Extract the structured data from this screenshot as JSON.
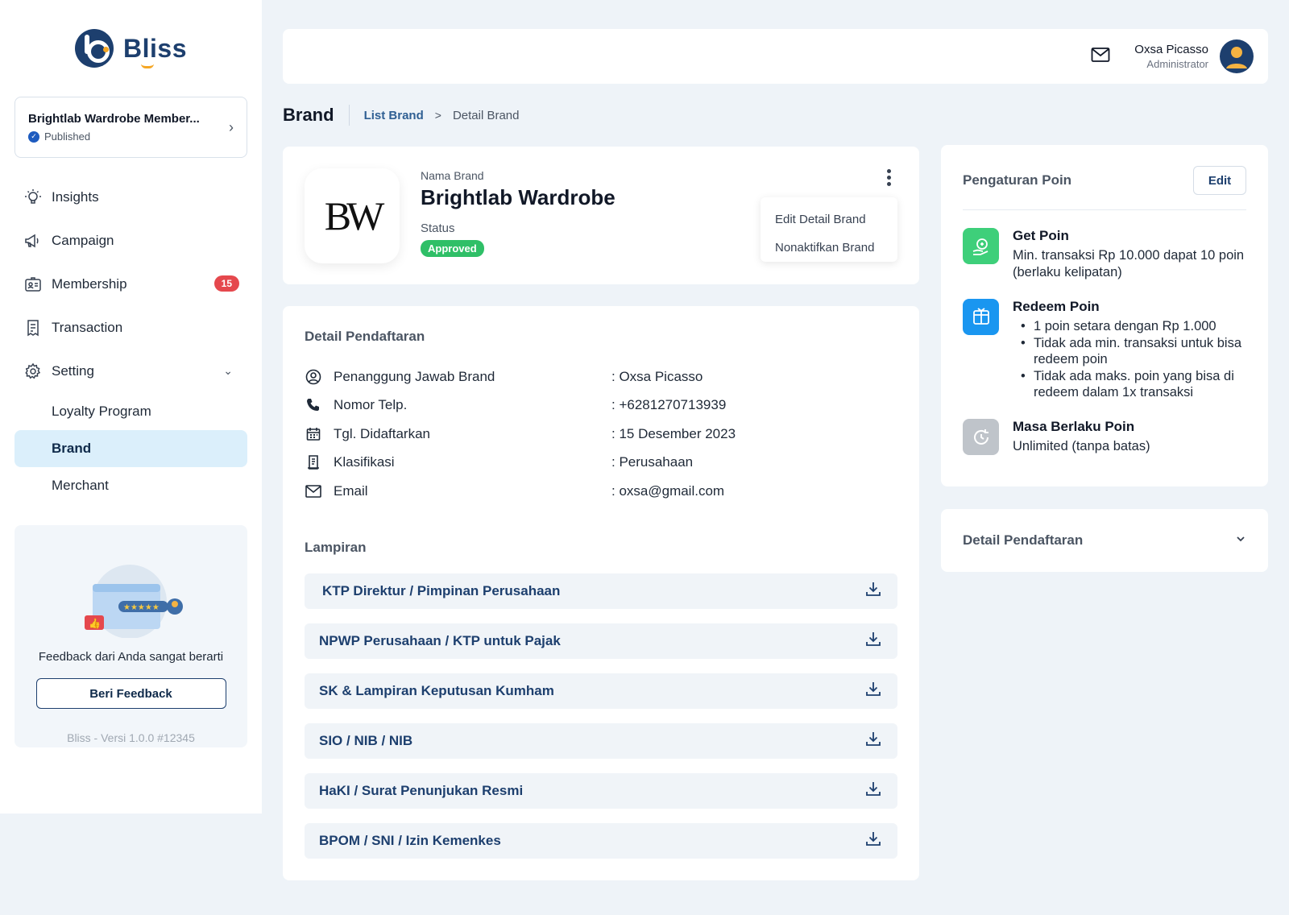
{
  "app": {
    "logo_text": "Bliss"
  },
  "project": {
    "name": "Brightlab Wardrobe Member...",
    "status": "Published"
  },
  "nav": {
    "insights": "Insights",
    "campaign": "Campaign",
    "membership": "Membership",
    "membership_badge": "15",
    "transaction": "Transaction",
    "setting": "Setting",
    "sub": {
      "loyalty": "Loyalty Program",
      "brand": "Brand",
      "merchant": "Merchant"
    }
  },
  "feedback": {
    "text": "Feedback dari Anda sangat berarti",
    "button": "Beri Feedback"
  },
  "version": "Bliss - Versi 1.0.0 #12345",
  "user": {
    "name": "Oxsa Picasso",
    "role": "Administrator"
  },
  "breadcrumb": {
    "title": "Brand",
    "link": "List Brand",
    "separator": ">",
    "current": "Detail Brand"
  },
  "brand": {
    "logo_text": "BW",
    "name_label": "Nama Brand",
    "name": "Brightlab Wardrobe",
    "status_label": "Status",
    "status": "Approved",
    "status_color": "#2fbf67",
    "menu": {
      "edit": "Edit Detail Brand",
      "deactivate": "Nonaktifkan Brand"
    }
  },
  "detail": {
    "title": "Detail Pendaftaran",
    "rows": [
      {
        "icon": "person-icon",
        "label": "Penanggung Jawab Brand",
        "value": ": Oxsa Picasso"
      },
      {
        "icon": "phone-icon",
        "label": "Nomor Telp.",
        "value": ": +6281270713939"
      },
      {
        "icon": "calendar-icon",
        "label": "Tgl. Didaftarkan",
        "value": ": 15 Desember 2023"
      },
      {
        "icon": "document-icon",
        "label": "Klasifikasi",
        "value": ": Perusahaan"
      },
      {
        "icon": "mail-icon",
        "label": "Email",
        "value": ": oxsa@gmail.com"
      }
    ],
    "attachments_title": "Lampiran",
    "attachments": [
      "KTP Direktur / Pimpinan Perusahaan",
      "NPWP Perusahaan / KTP untuk Pajak",
      "SK & Lampiran Keputusan Kumham",
      "SIO / NIB / NIB",
      "HaKI / Surat Penunjukan Resmi",
      "BPOM / SNI / Izin Kemenkes"
    ]
  },
  "poin": {
    "title": "Pengaturan Poin",
    "edit": "Edit",
    "get": {
      "title": "Get Poin",
      "desc": "Min. transaksi Rp 10.000 dapat 10 poin (berlaku kelipatan)",
      "color": "#3ecf7a"
    },
    "redeem": {
      "title": "Redeem Poin",
      "color": "#1a96f0",
      "bullets": [
        "1 poin setara dengan Rp 1.000",
        "Tidak ada min. transaksi untuk bisa redeem poin",
        "Tidak ada maks. poin yang bisa di redeem dalam 1x transaksi"
      ]
    },
    "expiry": {
      "title": "Masa Berlaku Poin",
      "desc": "Unlimited (tanpa batas)",
      "color": "#bfc4ca"
    }
  },
  "collapse": {
    "title": "Detail Pendaftaran"
  }
}
